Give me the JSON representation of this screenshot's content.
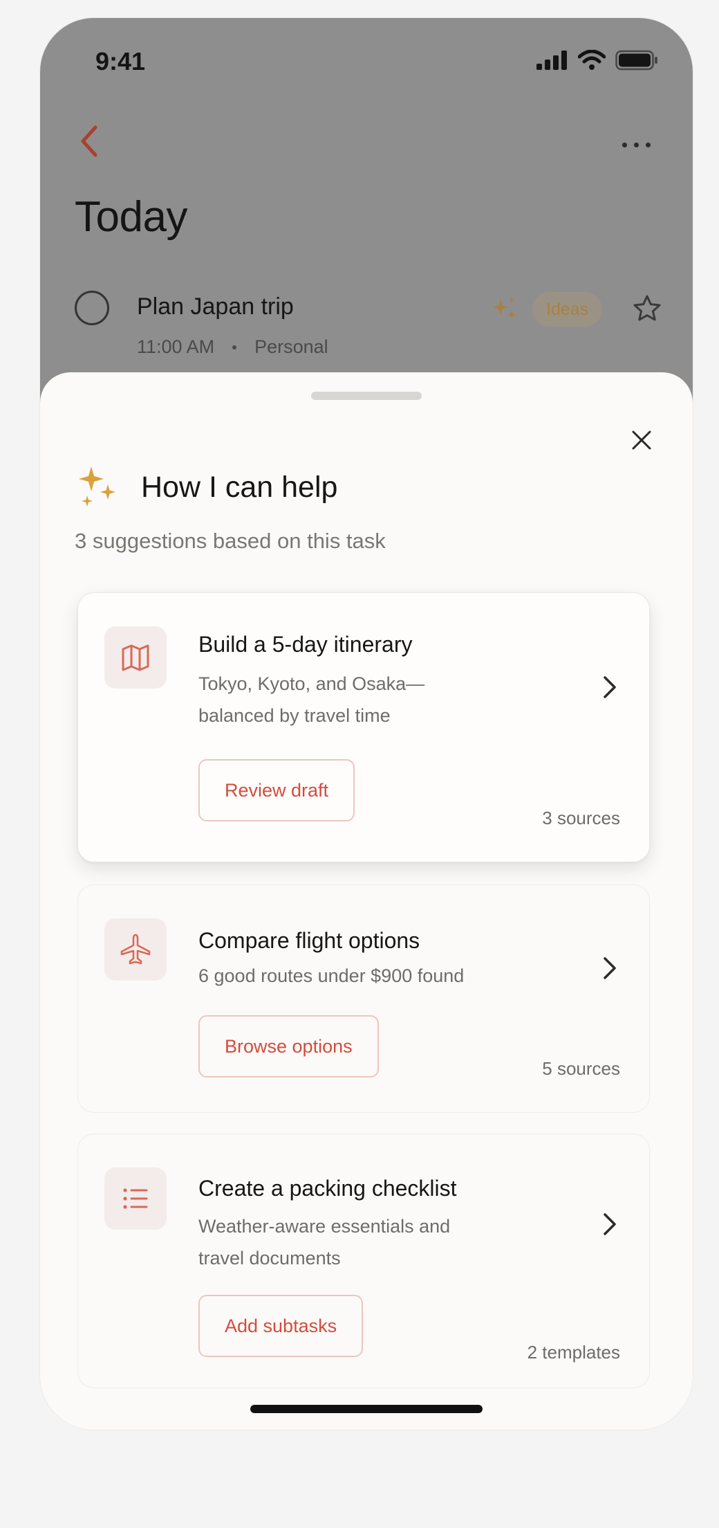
{
  "status_bar": {
    "time": "9:41"
  },
  "background_screen": {
    "title": "Today",
    "task": {
      "title": "Plan Japan trip",
      "time": "11:00 AM",
      "list": "Personal",
      "chip_label": "Ideas"
    }
  },
  "sheet": {
    "title": "How I can help",
    "subtitle": "3 suggestions based on this task",
    "cards": [
      {
        "icon": "map-icon",
        "title": "Build a 5-day itinerary",
        "description": "Tokyo, Kyoto, and Osaka—balanced by travel time",
        "button_label": "Review draft",
        "meta": "3 sources"
      },
      {
        "icon": "airplane-icon",
        "title": "Compare flight options",
        "description": "6 good routes under $900 found",
        "button_label": "Browse options",
        "meta": "5 sources"
      },
      {
        "icon": "list-icon",
        "title": "Create a packing checklist",
        "description": "Weather-aware essentials and travel documents",
        "button_label": "Add subtasks",
        "meta": "2 templates"
      }
    ]
  },
  "colors": {
    "accent": "#d44c3c",
    "sparkle": "#d9a23a",
    "dim_overlay": "#8e8e8e"
  }
}
